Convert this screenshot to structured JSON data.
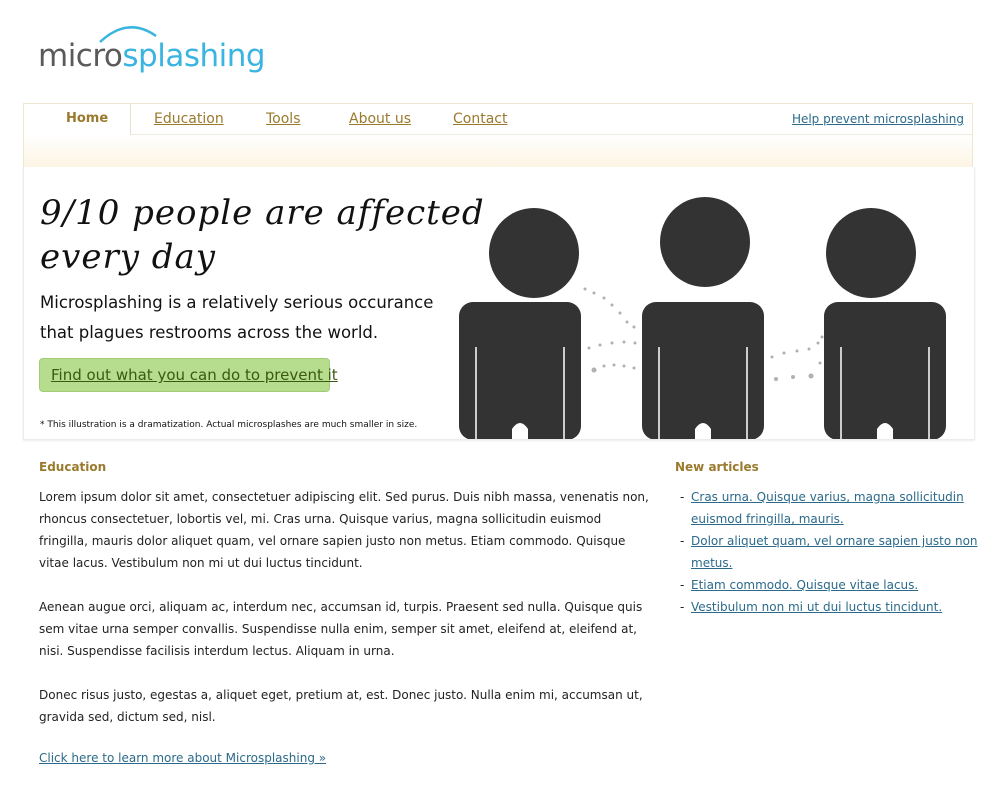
{
  "logo": {
    "part1": "micro",
    "part2": "splashing"
  },
  "nav": {
    "items": [
      {
        "label": "Home"
      },
      {
        "label": "Education"
      },
      {
        "label": "Tools"
      },
      {
        "label": "About us"
      },
      {
        "label": "Contact"
      }
    ],
    "help": "Help prevent microsplashing"
  },
  "hero": {
    "title": "9/10 people are affected every day",
    "text": "Microsplashing is a relatively serious occurance that plagues restrooms across the world.",
    "button": "Find out what you can do to prevent it",
    "note": "* This illustration is a dramatization. Actual microsplashes are much smaller in size."
  },
  "education": {
    "heading": "Education",
    "paragraphs": [
      "Lorem ipsum dolor sit amet, consectetuer adipiscing elit. Sed purus. Duis nibh massa, venenatis non, rhoncus consectetuer, lobortis vel, mi. Cras urna. Quisque varius, magna sollicitudin euismod fringilla, mauris dolor aliquet quam, vel ornare sapien justo non metus. Etiam commodo. Quisque vitae lacus. Vestibulum non mi ut dui luctus tincidunt.",
      "Aenean augue orci, aliquam ac, interdum nec, accumsan id, turpis. Praesent sed nulla. Quisque quis sem vitae urna semper convallis. Suspendisse nulla enim, semper sit amet, eleifend at, eleifend at, nisi. Suspendisse facilisis interdum lectus. Aliquam in urna.",
      "Donec risus justo, egestas a, aliquet eget, pretium at, est. Donec justo. Nulla enim mi, accumsan ut, gravida sed, dictum sed, nisl."
    ],
    "link": "Click here to learn more about Microsplashing »"
  },
  "new_articles": {
    "heading": "New articles",
    "items": [
      "Cras urna. Quisque varius, magna sollicitudin euismod fringilla, mauris.",
      "Dolor aliquet quam, vel ornare sapien justo non metus.",
      "Etiam commodo. Quisque vitae lacus.",
      "Vestibulum non mi ut dui luctus tincidunt."
    ]
  },
  "colors": {
    "accent_gold": "#9a7a2c",
    "link_blue": "#2b6a8a",
    "logo_blue": "#3ab4e0",
    "button_green": "#b6dc8e",
    "figure_dark": "#333333"
  }
}
